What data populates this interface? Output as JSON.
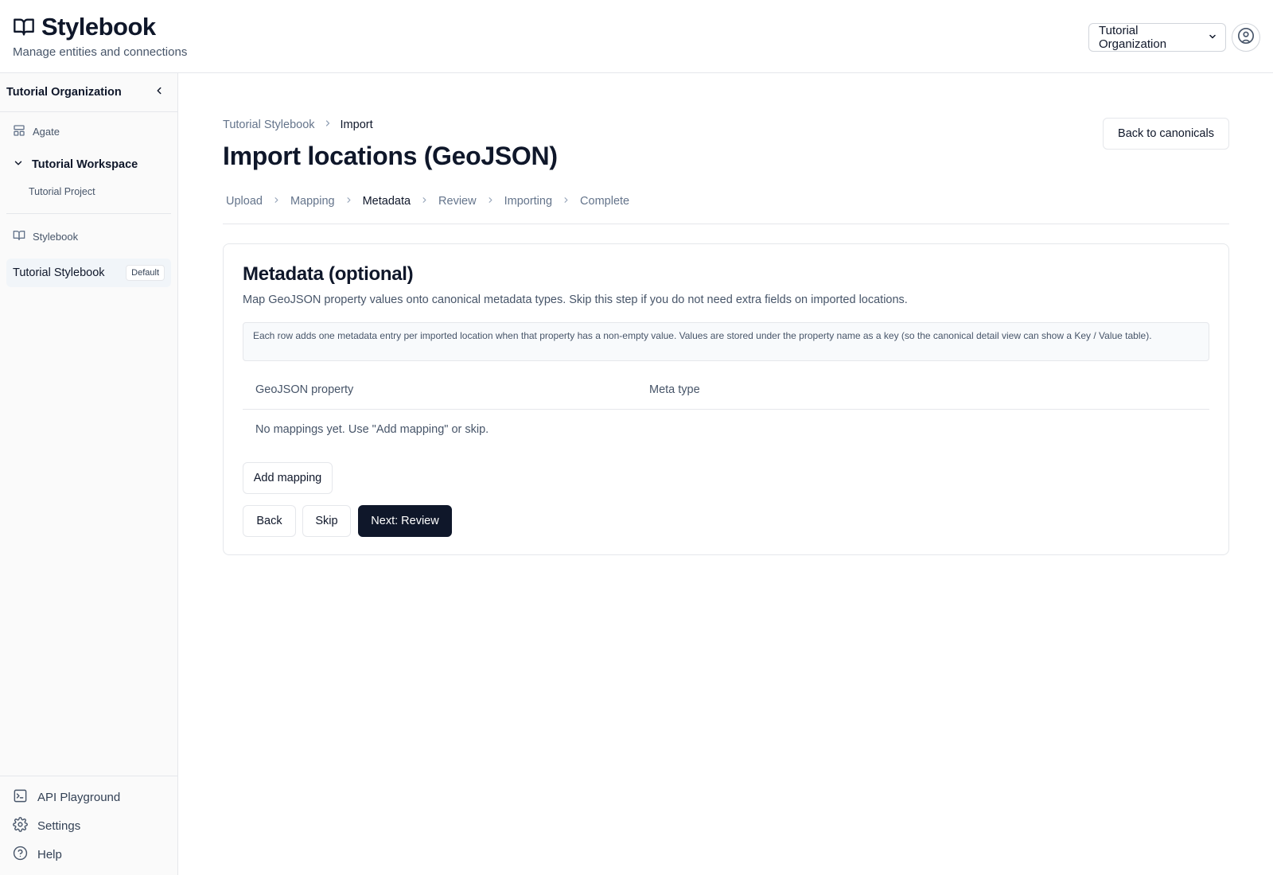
{
  "header": {
    "title": "Stylebook",
    "subtitle": "Manage entities and connections",
    "org_select": "Tutorial Organization"
  },
  "sidebar": {
    "org_name": "Tutorial Organization",
    "agate_label": "Agate",
    "workspace_label": "Tutorial Workspace",
    "project_label": "Tutorial Project",
    "stylebook_section": "Stylebook",
    "active_stylebook": "Tutorial Stylebook",
    "active_badge": "Default",
    "bottom": {
      "api": "API Playground",
      "settings": "Settings",
      "help": "Help"
    }
  },
  "main": {
    "breadcrumb": [
      "Tutorial Stylebook",
      "Import"
    ],
    "title": "Import locations (GeoJSON)",
    "back_button": "Back to canonicals",
    "steps": [
      "Upload",
      "Mapping",
      "Metadata",
      "Review",
      "Importing",
      "Complete"
    ],
    "active_step": "Metadata",
    "card": {
      "title": "Metadata (optional)",
      "description": "Map GeoJSON property values onto canonical metadata types. Skip this step if you do not need extra fields on imported locations.",
      "info": "Each row adds one metadata entry per imported location when that property has a non-empty value. Values are stored under the property name as a key (so the canonical detail view can show a Key / Value table).",
      "col_property": "GeoJSON property",
      "col_meta": "Meta type",
      "empty": "No mappings yet. Use \"Add mapping\" or skip.",
      "add_mapping": "Add mapping",
      "back": "Back",
      "skip": "Skip",
      "next": "Next: Review"
    }
  }
}
